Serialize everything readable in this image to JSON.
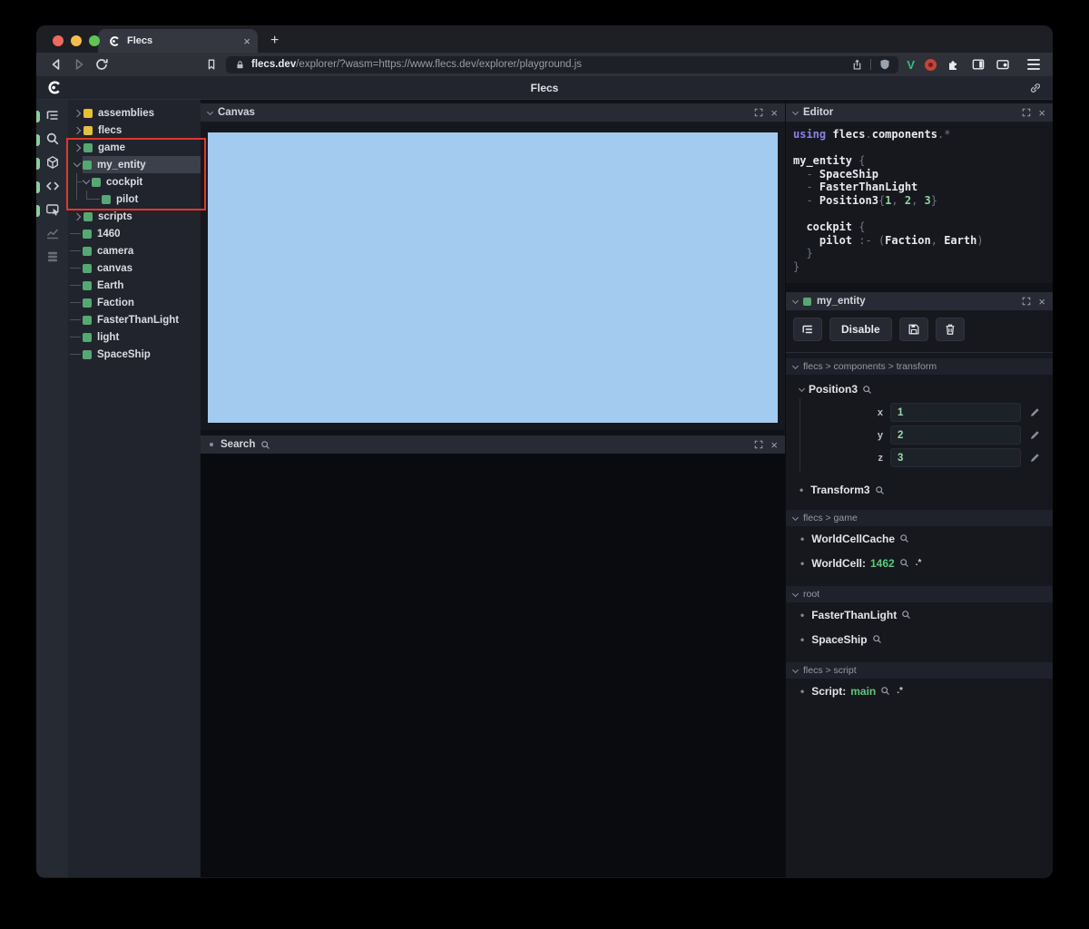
{
  "colors": {
    "accent_green": "#55a873",
    "accent_yellow": "#e5c03c",
    "annotation_red": "#df382b",
    "canvas_blue": "#a2cbef",
    "value_green": "#5ec878",
    "keyword_purple": "#8a82e8",
    "vue_green": "#41b883",
    "selected_row": "#3b404b"
  },
  "glyphs": {
    "close": "×",
    "plus": "+",
    "bullet": "•"
  },
  "browser": {
    "tab_title": "Flecs",
    "url_host": "flecs.dev",
    "url_rest": "/explorer/?wasm=https://www.flecs.dev/explorer/playground.js"
  },
  "header": {
    "title": "Flecs"
  },
  "sidebar": {
    "icons": [
      "entity-tree",
      "search",
      "entities",
      "code",
      "inspect",
      "statistics",
      "tables"
    ]
  },
  "tree": {
    "items": [
      {
        "label": "assemblies",
        "color": "yellow",
        "state": "collapsed"
      },
      {
        "label": "flecs",
        "color": "yellow",
        "state": "collapsed"
      },
      {
        "label": "game",
        "color": "green",
        "state": "collapsed"
      },
      {
        "label": "my_entity",
        "color": "green",
        "state": "expanded",
        "selected": true
      },
      {
        "label": "cockpit",
        "color": "green",
        "state": "expanded"
      },
      {
        "label": "pilot",
        "color": "green",
        "state": "leaf"
      },
      {
        "label": "scripts",
        "color": "green",
        "state": "collapsed"
      },
      {
        "label": "1460",
        "color": "green",
        "state": "leaf"
      },
      {
        "label": "camera",
        "color": "green",
        "state": "leaf"
      },
      {
        "label": "canvas",
        "color": "green",
        "state": "leaf"
      },
      {
        "label": "Earth",
        "color": "green",
        "state": "leaf"
      },
      {
        "label": "Faction",
        "color": "green",
        "state": "leaf"
      },
      {
        "label": "FasterThanLight",
        "color": "green",
        "state": "leaf"
      },
      {
        "label": "light",
        "color": "green",
        "state": "leaf"
      },
      {
        "label": "SpaceShip",
        "color": "green",
        "state": "leaf"
      }
    ]
  },
  "panels": {
    "canvas": {
      "title": "Canvas"
    },
    "search": {
      "title": "Search"
    },
    "editor": {
      "title": "Editor",
      "lines": [
        {
          "segs": [
            {
              "c": "kw",
              "t": "using "
            },
            {
              "c": "w",
              "t": "flecs"
            },
            {
              "c": "g",
              "t": "."
            },
            {
              "c": "w",
              "t": "components"
            },
            {
              "c": "g",
              "t": ".*"
            }
          ]
        },
        {
          "segs": []
        },
        {
          "segs": [
            {
              "c": "w",
              "t": "my_entity"
            },
            {
              "c": "g",
              "t": " {"
            }
          ]
        },
        {
          "segs": [
            {
              "c": "g",
              "t": "  - "
            },
            {
              "c": "w",
              "t": "SpaceShip"
            }
          ]
        },
        {
          "segs": [
            {
              "c": "g",
              "t": "  - "
            },
            {
              "c": "w",
              "t": "FasterThanLight"
            }
          ]
        },
        {
          "segs": [
            {
              "c": "g",
              "t": "  - "
            },
            {
              "c": "w",
              "t": "Position3"
            },
            {
              "c": "g",
              "t": "{"
            },
            {
              "c": "n",
              "t": "1"
            },
            {
              "c": "g",
              "t": ", "
            },
            {
              "c": "n",
              "t": "2"
            },
            {
              "c": "g",
              "t": ", "
            },
            {
              "c": "n",
              "t": "3"
            },
            {
              "c": "g",
              "t": "}"
            }
          ]
        },
        {
          "segs": []
        },
        {
          "segs": [
            {
              "c": "g",
              "t": "  "
            },
            {
              "c": "w",
              "t": "cockpit"
            },
            {
              "c": "g",
              "t": " {"
            }
          ]
        },
        {
          "segs": [
            {
              "c": "g",
              "t": "    "
            },
            {
              "c": "w",
              "t": "pilot"
            },
            {
              "c": "g",
              "t": " :- ("
            },
            {
              "c": "w",
              "t": "Faction"
            },
            {
              "c": "g",
              "t": ", "
            },
            {
              "c": "w",
              "t": "Earth"
            },
            {
              "c": "g",
              "t": ")"
            }
          ]
        },
        {
          "segs": [
            {
              "c": "g",
              "t": "  }"
            }
          ]
        },
        {
          "segs": [
            {
              "c": "g",
              "t": "}"
            }
          ]
        }
      ]
    },
    "inspector": {
      "title": "my_entity",
      "toolbar": {
        "disable": "Disable"
      },
      "sections": [
        {
          "path": "flecs > components > transform",
          "components": [
            {
              "name": "Position3",
              "fields": [
                {
                  "label": "x",
                  "value": "1"
                },
                {
                  "label": "y",
                  "value": "2"
                },
                {
                  "label": "z",
                  "value": "3"
                }
              ]
            },
            {
              "name": "Transform3"
            }
          ]
        },
        {
          "path": "flecs > game",
          "components": [
            {
              "name": "WorldCellCache"
            },
            {
              "name": "WorldCell:",
              "value": "1462",
              "suffix": ".*"
            }
          ]
        },
        {
          "path": "root",
          "components": [
            {
              "name": "FasterThanLight"
            },
            {
              "name": "SpaceShip"
            }
          ]
        },
        {
          "path": "flecs > script",
          "components": [
            {
              "name": "Script:",
              "value": "main",
              "suffix": ".*"
            }
          ]
        }
      ]
    }
  }
}
